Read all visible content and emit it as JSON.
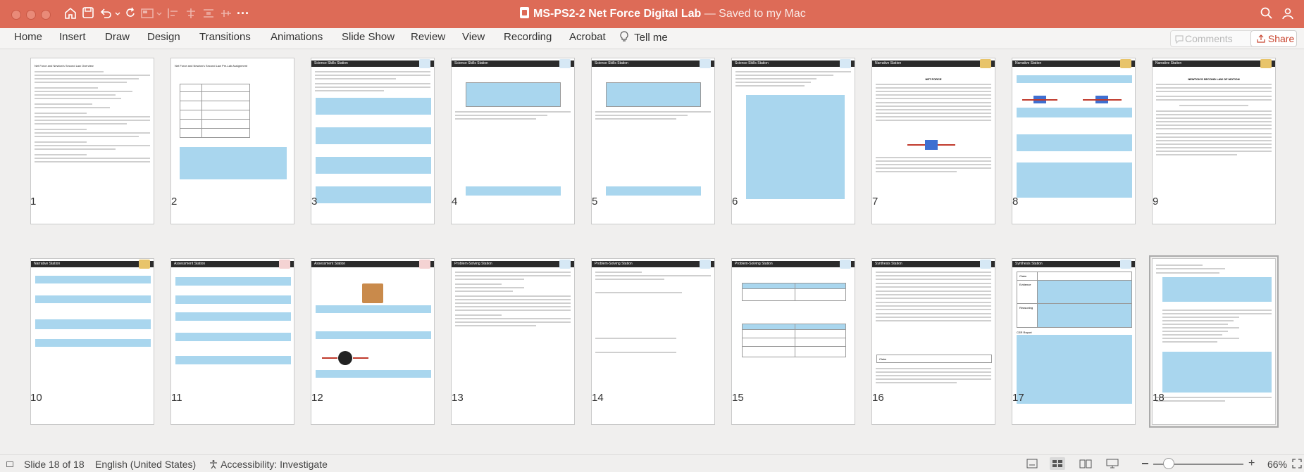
{
  "window": {
    "title": "MS-PS2-2 Net Force Digital Lab",
    "saved_status": "— Saved to my Mac",
    "accent_color": "#dd6b57"
  },
  "toolbar": {
    "icons": [
      "home-icon",
      "save-icon",
      "undo-icon",
      "redo-icon",
      "slide-layout-icon",
      "align-icon",
      "more-icon"
    ],
    "more_label": "···"
  },
  "ribbon": {
    "tabs": [
      "Home",
      "Insert",
      "Draw",
      "Design",
      "Transitions",
      "Animations",
      "Slide Show",
      "Review",
      "View",
      "Recording",
      "Acrobat"
    ],
    "tell_me": "Tell me",
    "comments_label": "Comments",
    "share_label": "Share"
  },
  "slides": [
    {
      "number": "1",
      "header": ""
    },
    {
      "number": "2",
      "header": ""
    },
    {
      "number": "3",
      "header": "Science Skills Station"
    },
    {
      "number": "4",
      "header": "Science Skills Station"
    },
    {
      "number": "5",
      "header": "Science Skills Station"
    },
    {
      "number": "6",
      "header": "Science Skills Station"
    },
    {
      "number": "7",
      "header": "Narrative Station"
    },
    {
      "number": "8",
      "header": "Narrative Station"
    },
    {
      "number": "9",
      "header": "Narrative Station"
    },
    {
      "number": "10",
      "header": "Narrative Station"
    },
    {
      "number": "11",
      "header": "Assessment Station"
    },
    {
      "number": "12",
      "header": "Assessment Station"
    },
    {
      "number": "13",
      "header": "Problem-Solving Station"
    },
    {
      "number": "14",
      "header": "Problem-Solving Station"
    },
    {
      "number": "15",
      "header": "Problem-Solving Station"
    },
    {
      "number": "16",
      "header": "Synthesis Station"
    },
    {
      "number": "17",
      "header": "Synthesis Station"
    },
    {
      "number": "18",
      "header": ""
    }
  ],
  "slide_text": {
    "s1_title": "Net Force and Newton's Second Law Overview",
    "s2_title": "Net Force and Newton's Second Law Pre-Lab Assignment",
    "s7_heading": "NET FORCE",
    "s9_heading": "NEWTON'S SECOND LAW OF MOTION",
    "s16_claim": "Claim",
    "s17_claim": "Claim",
    "s17_evidence": "Evidence",
    "s17_reasoning": "Reasoning",
    "s17_cer": "CER Report"
  },
  "status": {
    "slide_info": "Slide 18 of 18",
    "language": "English (United States)",
    "accessibility": "Accessibility: Investigate",
    "zoom": "66%",
    "zoom_level": 0.22
  }
}
